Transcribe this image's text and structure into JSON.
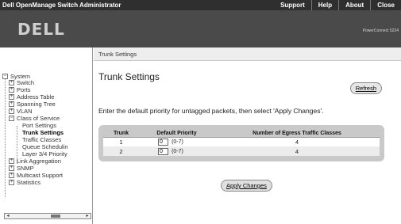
{
  "topbar": {
    "title": "Dell OpenManage Switch Administrator",
    "links": [
      "Support",
      "Help",
      "About",
      "Close"
    ]
  },
  "banner": {
    "logo": "DELL",
    "model": "PowerConnect 5224"
  },
  "tree": {
    "items": [
      {
        "label": "System",
        "toggle": "−",
        "selected": false
      },
      {
        "label": "Switch",
        "toggle": "+",
        "selected": false
      },
      {
        "label": "Ports",
        "toggle": "+",
        "selected": false
      },
      {
        "label": "Address Table",
        "toggle": "+",
        "selected": false
      },
      {
        "label": "Spanning Tree",
        "toggle": "+",
        "selected": false
      },
      {
        "label": "VLAN",
        "toggle": "+",
        "selected": false
      },
      {
        "label": "Class of Service",
        "toggle": "−",
        "selected": false
      },
      {
        "label": "Port Settings",
        "toggle": "",
        "selected": false
      },
      {
        "label": "Trunk Settings",
        "toggle": "",
        "selected": true
      },
      {
        "label": "Traffic Classes",
        "toggle": "",
        "selected": false
      },
      {
        "label": "Queue Schedulin",
        "toggle": "",
        "selected": false
      },
      {
        "label": "Layer 3/4 Priority",
        "toggle": "",
        "selected": false
      },
      {
        "label": "Link Aggregation",
        "toggle": "+",
        "selected": false
      },
      {
        "label": "SNMP",
        "toggle": "+",
        "selected": false
      },
      {
        "label": "Multicast Support",
        "toggle": "+",
        "selected": false
      },
      {
        "label": "Statistics",
        "toggle": "+",
        "selected": false
      }
    ]
  },
  "breadcrumb": "Trunk Settings",
  "main": {
    "title": "Trunk Settings",
    "refresh_label": "Refresh",
    "instruction": "Enter the default priority for untagged packets, then select 'Apply Changes'.",
    "table": {
      "headers": [
        "Trunk",
        "Default Priority",
        "Number of Egress Traffic Classes"
      ],
      "rows": [
        {
          "trunk": "1",
          "priority": "0",
          "range": "(0-7)",
          "classes": "4"
        },
        {
          "trunk": "2",
          "priority": "0",
          "range": "(0-7)",
          "classes": "4"
        }
      ]
    },
    "apply_label": "Apply Changes"
  },
  "colors": {
    "topbar": "#2f2f2f",
    "banner": "#4a4a4a",
    "table_bg": "#c9c9c9"
  }
}
